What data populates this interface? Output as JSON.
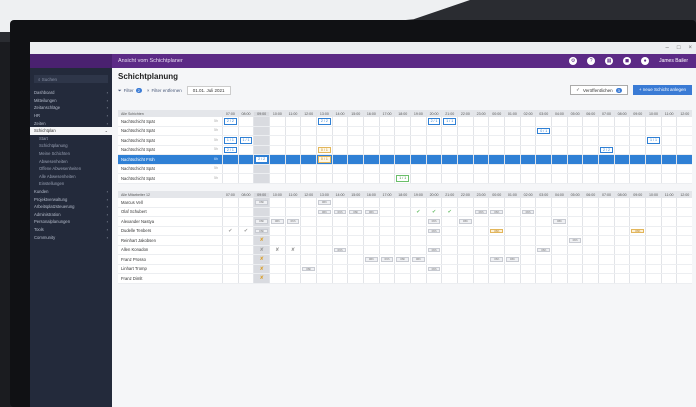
{
  "window": {
    "minimize": "–",
    "maximize": "□",
    "close": "×"
  },
  "appbar": {
    "title": "Ansicht vom Schichtplaner",
    "user": "James Bailer",
    "icons": [
      "settings-icon",
      "help-icon",
      "calendar-icon",
      "notification-icon",
      "user-avatar-icon"
    ]
  },
  "sidebar": {
    "search": "Suchen",
    "items": [
      {
        "label": "Dashboard",
        "chev": "›",
        "sub": false
      },
      {
        "label": "Mitteilungen",
        "chev": "›",
        "sub": false
      },
      {
        "label": "Zeitanschläge",
        "chev": "›",
        "sub": false
      },
      {
        "label": "HR",
        "chev": "›",
        "sub": false
      },
      {
        "label": "Zeiten",
        "chev": "›",
        "sub": false
      },
      {
        "label": "Schichtplan",
        "chev": "⌄",
        "sub": false,
        "active": true
      },
      {
        "label": "Start",
        "chev": "",
        "sub": true
      },
      {
        "label": "Schichtplanung",
        "chev": "",
        "sub": true
      },
      {
        "label": "Meine Schichten",
        "chev": "",
        "sub": true
      },
      {
        "label": "Abwesenheiten",
        "chev": "",
        "sub": true
      },
      {
        "label": "Offene Abwesenheiten",
        "chev": "",
        "sub": true
      },
      {
        "label": "Alle Abwesenheiten",
        "chev": "",
        "sub": true
      },
      {
        "label": "Einstellungen",
        "chev": "",
        "sub": true
      },
      {
        "label": "Kunden",
        "chev": "›",
        "sub": false
      },
      {
        "label": "Projektverwaltung",
        "chev": "›",
        "sub": false
      },
      {
        "label": "Arbeitsplatzsteuerung",
        "chev": "›",
        "sub": false
      },
      {
        "label": "Administration",
        "chev": "›",
        "sub": false
      },
      {
        "label": "Personalplanungen",
        "chev": "›",
        "sub": false
      },
      {
        "label": "Tools",
        "chev": "›",
        "sub": false
      },
      {
        "label": "Community",
        "chev": "›",
        "sub": false
      }
    ]
  },
  "page": {
    "title": "Schichtplanung",
    "filter": "Filter",
    "filter_count": "2",
    "reset_filter": "Filter entfernen",
    "date": "01.01. Juli 2021",
    "publish_btn": "Veröffentlichen",
    "publish_count": "3",
    "new_shift_btn": "+ neue Schicht anlegen"
  },
  "top_table": {
    "header_label": "Alle Schichten",
    "times": [
      "07:00",
      "08:00",
      "09:00",
      "10:00",
      "11:00",
      "12:00",
      "13:00",
      "14:00",
      "15:00",
      "16:00",
      "17:00",
      "18:00",
      "19:00",
      "20:00",
      "21:00",
      "22:00",
      "23:00",
      "00:00",
      "01:00",
      "02:00",
      "03:00",
      "04:00",
      "05:00",
      "06:00",
      "07:00",
      "08:00",
      "09:00",
      "10:00",
      "11:00",
      "12:00"
    ],
    "rows": [
      {
        "label": "Nachtschicht Spät",
        "time": "5h",
        "shifts": [
          {
            "col": 0,
            "text": "2 / 2"
          },
          {
            "col": 6,
            "text": "2 / 2"
          },
          {
            "col": 13,
            "text": "2 / 1"
          },
          {
            "col": 14,
            "text": "1 / 1"
          }
        ]
      },
      {
        "label": "Nachtschicht Spät",
        "time": "5h",
        "shifts": [
          {
            "col": 20,
            "text": "0 / 1"
          }
        ]
      },
      {
        "label": "Nachtschicht Spät",
        "time": "5h",
        "shifts": [
          {
            "col": 0,
            "text": "1 / 1"
          },
          {
            "col": 1,
            "text": "1 / 1"
          },
          {
            "col": 27,
            "text": "1 / 1"
          }
        ]
      },
      {
        "label": "Nachtschicht Spät",
        "time": "5h",
        "shifts": [
          {
            "col": 0,
            "text": "2 / 1"
          },
          {
            "col": 6,
            "text": "0 / 1",
            "y": true
          },
          {
            "col": 24,
            "text": "2 / 2"
          }
        ]
      },
      {
        "label": "Nachtschicht Früh",
        "time": "6h",
        "sel": true,
        "shifts": [
          {
            "col": 2,
            "text": "2 / 2"
          },
          {
            "col": 6,
            "text": "0 / 1",
            "y": true
          }
        ]
      },
      {
        "label": "Nachtschicht Spät",
        "time": "5h",
        "shifts": []
      },
      {
        "label": "Nachtschicht Spät",
        "time": "5h",
        "shifts": [
          {
            "col": 11,
            "text": "1 / 1",
            "g": true
          }
        ]
      }
    ]
  },
  "bottom_table": {
    "header_label": "Alle Mitarbeiter",
    "header_count": "12",
    "times": [
      "07:00",
      "08:00",
      "09:00",
      "10:00",
      "11:00",
      "12:00",
      "13:00",
      "14:00",
      "15:00",
      "16:00",
      "17:00",
      "18:00",
      "19:00",
      "20:00",
      "21:00",
      "22:00",
      "23:00",
      "00:00",
      "01:00",
      "02:00",
      "03:00",
      "04:00",
      "05:00",
      "06:00",
      "07:00",
      "08:00",
      "09:00",
      "10:00",
      "11:00",
      "12:00"
    ],
    "rows": [
      {
        "label": "Marcus Vell",
        "items": [
          {
            "col": 2,
            "t": "pill",
            "text": "06h"
          },
          {
            "col": 6,
            "t": "pill",
            "text": "06h"
          }
        ]
      },
      {
        "label": "Olaf Schubert",
        "items": [
          {
            "col": 6,
            "t": "pill",
            "text": "06h"
          },
          {
            "col": 7,
            "t": "pill",
            "text": "06h"
          },
          {
            "col": 8,
            "t": "pill",
            "text": "06h"
          },
          {
            "col": 9,
            "t": "pill",
            "text": "06h"
          },
          {
            "col": 12,
            "t": "mark",
            "text": "✔"
          },
          {
            "col": 13,
            "t": "mark",
            "text": "✔"
          },
          {
            "col": 14,
            "t": "mark",
            "text": "✔"
          },
          {
            "col": 16,
            "t": "pill",
            "text": "06h"
          },
          {
            "col": 17,
            "t": "pill",
            "text": "06h"
          },
          {
            "col": 19,
            "t": "pill",
            "text": "06h"
          }
        ]
      },
      {
        "label": "Alexander Nastya",
        "items": [
          {
            "col": 2,
            "t": "pill",
            "text": "06h"
          },
          {
            "col": 3,
            "t": "pill",
            "text": "06h"
          },
          {
            "col": 4,
            "t": "pill",
            "text": "06h"
          },
          {
            "col": 13,
            "t": "pill",
            "text": "06h"
          },
          {
            "col": 15,
            "t": "pill",
            "text": "06h"
          },
          {
            "col": 21,
            "t": "pill",
            "text": "06h"
          }
        ]
      },
      {
        "label": "Dudelle Tenbers",
        "items": [
          {
            "col": 0,
            "t": "markx",
            "text": "✔"
          },
          {
            "col": 1,
            "t": "markx",
            "text": "✔"
          },
          {
            "col": 2,
            "t": "pill",
            "text": "06h"
          },
          {
            "col": 13,
            "t": "pill",
            "text": "06h"
          },
          {
            "col": 17,
            "t": "pillo",
            "text": "06h"
          },
          {
            "col": 26,
            "t": "pillo",
            "text": "06h"
          },
          {
            "col": 30,
            "t": "pillo",
            "text": "06h"
          }
        ]
      },
      {
        "label": "Reinhart Jakobsen",
        "items": [
          {
            "col": 2,
            "t": "markw",
            "text": "✘"
          },
          {
            "col": 22,
            "t": "pill",
            "text": "06h"
          }
        ]
      },
      {
        "label": "Allen Konadon",
        "items": [
          {
            "col": 2,
            "t": "markx",
            "text": "✘"
          },
          {
            "col": 3,
            "t": "markx",
            "text": "✘"
          },
          {
            "col": 4,
            "t": "markx",
            "text": "✘"
          },
          {
            "col": 7,
            "t": "pill",
            "text": "06h"
          },
          {
            "col": 13,
            "t": "pill",
            "text": "06h"
          },
          {
            "col": 20,
            "t": "pill",
            "text": "06h"
          }
        ]
      },
      {
        "label": "Franz Prosso",
        "items": [
          {
            "col": 2,
            "t": "markw",
            "text": "✘"
          },
          {
            "col": 9,
            "t": "pill",
            "text": "06h"
          },
          {
            "col": 10,
            "t": "pill",
            "text": "06h"
          },
          {
            "col": 11,
            "t": "pill",
            "text": "06h"
          },
          {
            "col": 12,
            "t": "pill",
            "text": "06h"
          },
          {
            "col": 17,
            "t": "pill",
            "text": "06h"
          },
          {
            "col": 18,
            "t": "pill",
            "text": "06h"
          }
        ]
      },
      {
        "label": "Linhart Tromp",
        "items": [
          {
            "col": 2,
            "t": "markw",
            "text": "✘"
          },
          {
            "col": 5,
            "t": "pill",
            "text": "06h"
          },
          {
            "col": 13,
            "t": "pill",
            "text": "06h"
          }
        ]
      },
      {
        "label": "Franz Dimlt",
        "items": [
          {
            "col": 2,
            "t": "markw",
            "text": "✘"
          }
        ]
      }
    ]
  }
}
